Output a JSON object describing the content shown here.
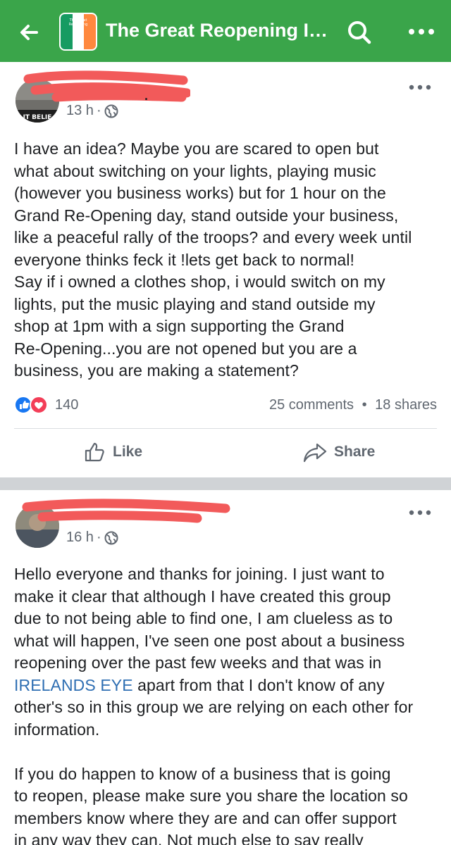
{
  "header": {
    "title": "The Great Reopening Irel...",
    "avatar_caption": "The Great Reopening",
    "colors": {
      "bar": "#3aa54a",
      "text": "#ffffff"
    },
    "icons": [
      "back-arrow-icon",
      "search-icon",
      "more-icon"
    ]
  },
  "posts": [
    {
      "time": "13 h",
      "separator": "·",
      "privacy_icon": "globe-icon",
      "body_lines": [
        "I have an idea? Maybe you are scared to open but",
        "what about switching on your lights, playing music",
        "(however you business works) but for 1 hour on the",
        "Grand Re-Opening day, stand outside your business,",
        "like a peaceful rally of the troops? and every week until",
        "everyone thinks feck it !lets get back to normal!",
        "Say if i owned a clothes shop, i would switch on my",
        "lights, put the music playing and stand outside my",
        "shop at 1pm with a sign supporting the Grand",
        "Re-Opening...you are not opened but you are a",
        "business, you are making a statement?"
      ],
      "avatar_text": "IT BELIE",
      "reaction_count": "140",
      "comments": "25 comments",
      "engage_sep": "•",
      "shares": "18 shares",
      "like_label": "Like",
      "share_label": "Share"
    },
    {
      "time": "16 h",
      "separator": "·",
      "privacy_icon": "globe-icon",
      "body_lines_a": [
        "Hello everyone and thanks for joining. I just want to",
        "make it clear that although I have created this group",
        "due to not being able to find one, I am clueless as to",
        "what will happen, I've seen one post about a business",
        "reopening over the past few weeks and that was in"
      ],
      "link_text": "IRELANDS EYE",
      "link_after": " apart from that I don't know of any",
      "body_lines_b": [
        "other's so in this group we are relying on each other for",
        "information."
      ],
      "body_lines_c": [
        "If you do happen to know of a business that is going",
        "to reopen, please make sure you share the location so",
        "members know where they are and can offer support",
        "in any way they can. Not much else to say really"
      ]
    }
  ],
  "colors": {
    "redaction": "#f25a5a",
    "link": "#2f6fb3",
    "divider": "#d0d3d6"
  }
}
